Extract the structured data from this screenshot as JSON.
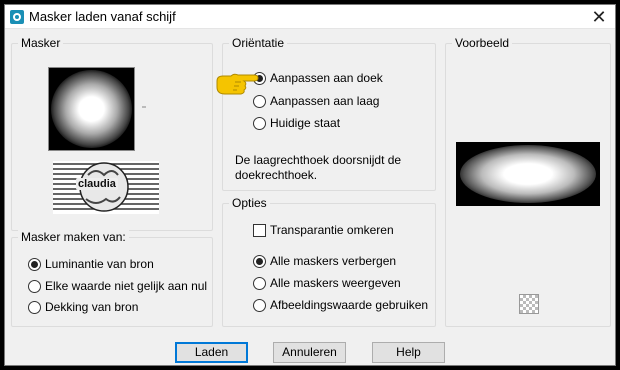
{
  "window": {
    "title": "Masker laden vanaf schijf"
  },
  "masker_group": {
    "legend": "Masker",
    "thumb_caption": "claudia"
  },
  "maken_group": {
    "legend": "Masker maken van:",
    "options": [
      {
        "label": "Luminantie van bron",
        "checked": true
      },
      {
        "label": "Elke waarde niet gelijk aan nul",
        "checked": false
      },
      {
        "label": "Dekking van bron",
        "checked": false
      }
    ]
  },
  "orientatie_group": {
    "legend": "Oriëntatie",
    "options": [
      {
        "label": "Aanpassen aan doek",
        "checked": true
      },
      {
        "label": "Aanpassen aan laag",
        "checked": false
      },
      {
        "label": "Huidige staat",
        "checked": false
      }
    ],
    "info_text": "De laagrechthoek doorsnijdt de doekrechthoek."
  },
  "opties_group": {
    "legend": "Opties",
    "checkbox_label": "Transparantie omkeren",
    "options": [
      {
        "label": "Alle maskers verbergen",
        "checked": true
      },
      {
        "label": "Alle maskers weergeven",
        "checked": false
      },
      {
        "label": "Afbeeldingswaarde gebruiken",
        "checked": false
      }
    ]
  },
  "voorbeeld_group": {
    "legend": "Voorbeeld"
  },
  "buttons": {
    "load": "Laden",
    "cancel": "Annuleren",
    "help": "Help"
  },
  "colors": {
    "accent": "#0078d7",
    "pointer_hand": "#f5c400"
  }
}
